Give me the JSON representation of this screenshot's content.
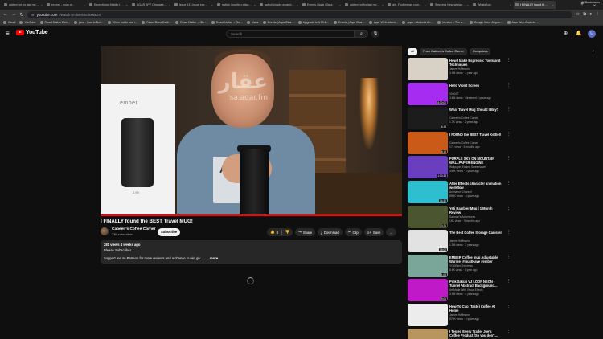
{
  "browser": {
    "tabs": [
      {
        "label": "add event for last mo…",
        "active": false
      },
      {
        "label": "exxxxx - expo w…",
        "active": false
      },
      {
        "label": "Exceptional Mobile t…",
        "active": false
      },
      {
        "label": "AQAR APP Changes …",
        "active": false
      },
      {
        "label": "issue #13 issue exc…",
        "active": false
      },
      {
        "label": "switch (position abso…",
        "active": false
      },
      {
        "label": "switch plugin unused …",
        "active": false
      },
      {
        "label": "Events | Aqar Glass",
        "active": false
      },
      {
        "label": "add event for last mo…",
        "active": false
      },
      {
        "label": "git - Find merge com…",
        "active": false
      },
      {
        "label": "Stepping New design …",
        "active": false
      },
      {
        "label": "WhatsApp",
        "active": false
      },
      {
        "label": "I FINALLY found th…",
        "active": true
      }
    ],
    "url_host": "youtube.com",
    "url_path": "/watch?v=ix9XmcSMBD4",
    "bookmarks": [
      "Gmail",
      "YouTube",
      "React Native Deb…",
      "java - how to Del…",
      "When not to use i…",
      "React Docs Getti…",
      "React Native – Gle…",
      "React Native > Ge…",
      "Maps",
      "Events | Aqar Glas…",
      "Upgrade to A 93 &…",
      "Events | Aqar Glas…",
      "Aqar Web Admin…",
      "Aqar – Android Ap…",
      "Version – The a…",
      "Google Meet Jetpac…",
      "Aqar Web A admin…"
    ],
    "bookmarks_all": "All Bookmarks"
  },
  "youtube": {
    "logo": "YouTube",
    "search_placeholder": "Search",
    "avatar_letter": "U"
  },
  "video": {
    "watermark_arabic": "عقار",
    "watermark_site": "sa.aqar.fm",
    "box_brand": "ember",
    "box_code": "2.99",
    "shirt_text": "AP",
    "title": "I FINALLY found the BEST Travel MUG!",
    "channel_name": "Cabeen's Coffee Corner",
    "channel_subs": "23K subscribers",
    "subscribe_label": "Subscribe",
    "likes": "8",
    "share_label": "Share",
    "download_label": "Download",
    "clip_label": "Clip",
    "save_label": "Save",
    "more_label": "…",
    "desc_meta": "281 views  4 weeks ago",
    "desc_line1": "Please Subscribe!",
    "desc_line2": "Support me on Patreon for more reviews and a chance to win giv…",
    "desc_more": "...more"
  },
  "sidebar": {
    "chips": [
      {
        "label": "All",
        "selected": true
      },
      {
        "label": "From Cabeen's Coffee Corner",
        "selected": false
      },
      {
        "label": "Computers",
        "selected": false
      }
    ],
    "recommendations": [
      {
        "title": "How I Make Espresso: Tools and Techniques",
        "channel": "James Hoffmann",
        "meta": "3.9M views · 1 year ago",
        "duration": "",
        "thumb": "#d8d2c6"
      },
      {
        "title": "Hello Violet Screen",
        "channel": "VIOLET",
        "meta": "3.6M views · Streamed 2 years ago",
        "duration": "8:00:00",
        "thumb": "#a62cf2"
      },
      {
        "title": "What Travel Mug Should I Buy?",
        "channel": "Cabeen's Coffee Corner",
        "meta": "1.7K views · 2 years ago",
        "duration": "6:28",
        "thumb": "#1c1c1c"
      },
      {
        "title": "I FOUND the BEST Travel Kettle!!",
        "channel": "Cabeen's Coffee Corner",
        "meta": "171 views · 5 months ago",
        "duration": "8:15",
        "thumb": "#c95a18"
      },
      {
        "title": "PURPLE SKY ON MOUNTAIN WALLPAPER ENGINE",
        "channel": "Wallpaper Engine Screensaver",
        "meta": "449K views · 5 years ago",
        "duration": "1:03:35",
        "thumb": "#6a3fbf"
      },
      {
        "title": "After Effects character animation workflow",
        "channel": "Animation Channel",
        "meta": "896K views · 4 years ago",
        "duration": "14:30",
        "thumb": "#2dbfcf"
      },
      {
        "title": "Yeti Rambler Mug | 1 Month Review",
        "channel": "Samoon's Adventures",
        "meta": "15K views · 9 months ago",
        "duration": "3:21",
        "thumb": "#4b5530"
      },
      {
        "title": "The Best Coffee Storage Canister",
        "channel": "James Hoffmann",
        "meta": "1.5M views · 2 years ago",
        "duration": "15:02",
        "thumb": "#e2e2e2"
      },
      {
        "title": "EMBER Coffee mug Adjustable Warmer #mustHave #ember",
        "channel": "YOUEarnChristmas",
        "meta": "8.6K views · 1 year ago",
        "duration": "1:06",
        "thumb": "#7aa69a"
      },
      {
        "title": "Pink Sakuh VJ LOOP NEON - Tunnel Abstract Background…",
        "channel": "Art Made With Visual Effects",
        "meta": "3.9M views · 4 years ago",
        "duration": "5:00",
        "thumb": "#c01ac8"
      },
      {
        "title": "How To Cup (Taste) Coffee At Home",
        "channel": "James Hoffmann",
        "meta": "870K views · 4 years ago",
        "duration": "",
        "thumb": "#ececec"
      },
      {
        "title": "I Tested Every Trader Joe's Coffee Product (So you don't…",
        "channel": "Morgan's Kitchen",
        "meta": "",
        "duration": "",
        "thumb": "#b8955e"
      }
    ]
  }
}
